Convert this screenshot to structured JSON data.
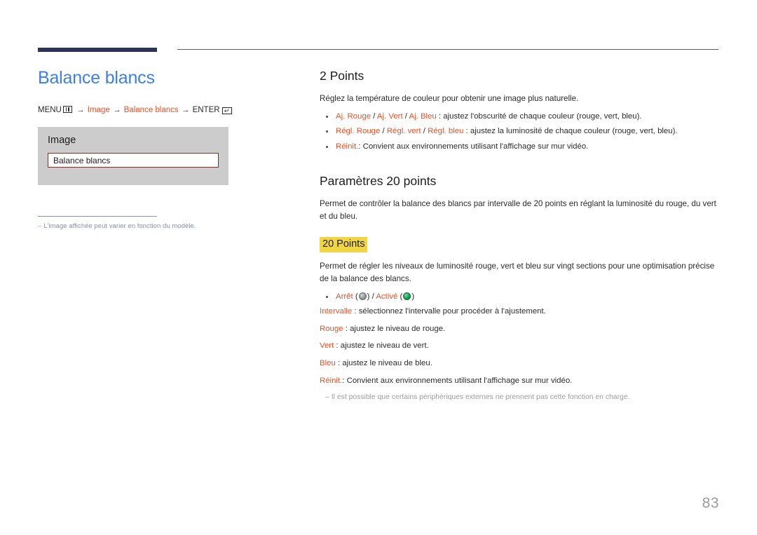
{
  "colors": {
    "accent_red": "#e8512a",
    "title_blue": "#3d7fe8",
    "rule_navy": "#2e3353",
    "highlight_yellow": "#f0d544",
    "note_gray": "#8a8fa8"
  },
  "left": {
    "title": "Balance blancs",
    "breadcrumb": {
      "menu_label": "MENU",
      "menu_icon": "menu-grid-icon",
      "arrow1": "→",
      "path1": "Image",
      "arrow2": "→",
      "path2": "Balance blancs",
      "arrow3": "→",
      "enter_label": "ENTER",
      "enter_icon": "enter-key-icon",
      "enter_glyph": "↵"
    },
    "menu_panel": {
      "title": "Image",
      "selected_item": "Balance blancs"
    },
    "note": {
      "dash": "‒",
      "text": "L'image affichée peut varier en fonction du modèle."
    }
  },
  "right": {
    "section1": {
      "heading": "2 Points",
      "intro": "Réglez la température de couleur pour obtenir une image plus naturelle.",
      "bullets": [
        {
          "terms": [
            "Aj. Rouge",
            "Aj. Vert",
            "Aj. Bleu"
          ],
          "rest": " : ajustez l'obscurité de chaque couleur (rouge, vert, bleu)."
        },
        {
          "terms": [
            "Régl. Rouge",
            "Régl. vert",
            "Régl. bleu"
          ],
          "rest": " : ajustez la luminosité de chaque couleur (rouge, vert, bleu)."
        },
        {
          "terms": [
            "Réinit."
          ],
          "rest": ": Convient aux environnements utilisant l'affichage sur mur vidéo."
        }
      ]
    },
    "section2": {
      "heading": "Paramètres 20 points",
      "intro": "Permet de contrôler la balance des blancs par intervalle de 20 points en réglant la luminosité du rouge, du vert et du bleu.",
      "highlight_term": "20 Points",
      "description": "Permet de régler les niveaux de luminosité rouge, vert et bleu sur vingt sections pour une optimisation précise de la balance des blancs.",
      "toggle_bullet": {
        "off_label": "Arrêt",
        "off_icon": "toggle-off-circle-icon",
        "divider": " / ",
        "on_label": "Activé",
        "on_icon": "toggle-on-circle-icon",
        "open_paren": "(",
        "close_paren": ")"
      },
      "lines": [
        {
          "term": "Intervalle",
          "rest": " : sélectionnez l'intervalle pour procéder à l'ajustement."
        },
        {
          "term": "Rouge",
          "rest": " : ajustez le niveau de rouge."
        },
        {
          "term": "Vert",
          "rest": " : ajustez le niveau de vert."
        },
        {
          "term": "Bleu",
          "rest": " : ajustez le niveau de bleu."
        },
        {
          "term": "Réinit.",
          "rest": ": Convient aux environnements utilisant l'affichage sur mur vidéo."
        }
      ],
      "note": {
        "dash": "‒",
        "text": "Il est possible que certains périphériques externes ne prennent pas cette fonction en charge."
      }
    }
  },
  "page_number": "83"
}
